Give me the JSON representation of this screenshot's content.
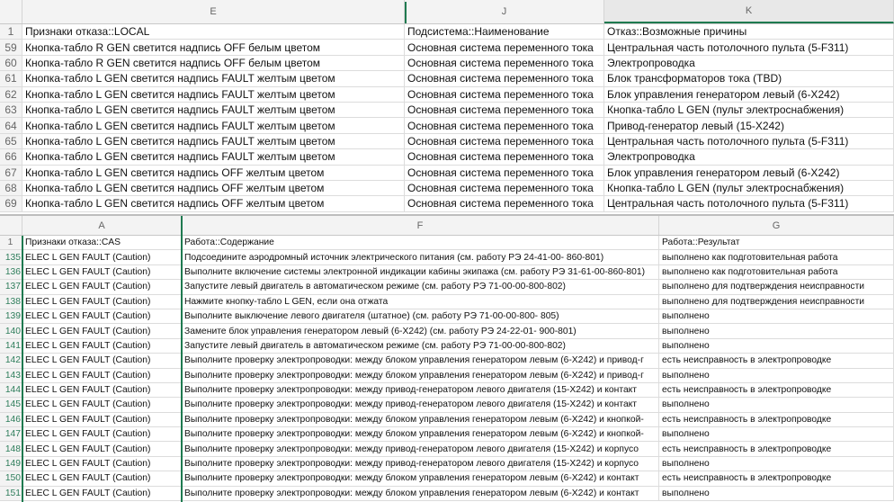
{
  "top_pane": {
    "columns": [
      "E",
      "J",
      "K"
    ],
    "header_row": {
      "num": "1",
      "cells": [
        "Признаки отказа::LOCAL",
        "Подсистема::Наименование",
        "Отказ::Возможные причины"
      ]
    },
    "rows": [
      {
        "num": "59",
        "cells": [
          "Кнопка-табло R GEN светится надпись OFF белым цветом",
          "Основная система переменного тока",
          "Центральная часть потолочного пульта (5-F311)"
        ]
      },
      {
        "num": "60",
        "cells": [
          "Кнопка-табло R GEN светится надпись OFF белым цветом",
          "Основная система переменного тока",
          "Электропроводка"
        ]
      },
      {
        "num": "61",
        "cells": [
          "Кнопка-табло L GEN светится надпись FAULT желтым цветом",
          "Основная система переменного тока",
          "Блок трансформаторов тока (TBD)"
        ]
      },
      {
        "num": "62",
        "cells": [
          "Кнопка-табло L GEN светится надпись FAULT желтым цветом",
          "Основная система переменного тока",
          "Блок управления генератором левый (6-X242)"
        ]
      },
      {
        "num": "63",
        "cells": [
          "Кнопка-табло L GEN светится надпись FAULT желтым цветом",
          "Основная система переменного тока",
          "Кнопка-табло L GEN (пульт электроснабжения)"
        ]
      },
      {
        "num": "64",
        "cells": [
          "Кнопка-табло L GEN светится надпись FAULT желтым цветом",
          "Основная система переменного тока",
          "Привод-генератор левый (15-X242)"
        ]
      },
      {
        "num": "65",
        "cells": [
          "Кнопка-табло L GEN светится надпись FAULT желтым цветом",
          "Основная система переменного тока",
          "Центральная часть потолочного пульта (5-F311)"
        ]
      },
      {
        "num": "66",
        "cells": [
          "Кнопка-табло L GEN светится надпись FAULT желтым цветом",
          "Основная система переменного тока",
          "Электропроводка"
        ]
      },
      {
        "num": "67",
        "cells": [
          "Кнопка-табло L GEN светится надпись OFF желтым цветом",
          "Основная система переменного тока",
          "Блок управления генератором левый (6-X242)"
        ]
      },
      {
        "num": "68",
        "cells": [
          "Кнопка-табло L GEN светится надпись OFF желтым цветом",
          "Основная система переменного тока",
          "Кнопка-табло L GEN (пульт электроснабжения)"
        ]
      },
      {
        "num": "69",
        "cells": [
          "Кнопка-табло L GEN светится надпись OFF желтым цветом",
          "Основная система переменного тока",
          "Центральная часть потолочного пульта (5-F311)"
        ]
      }
    ]
  },
  "bottom_pane": {
    "columns": [
      "A",
      "F",
      "G"
    ],
    "header_row": {
      "num": "1",
      "cells": [
        "Признаки отказа::CAS",
        "Работа::Содержание",
        "Работа::Результат"
      ]
    },
    "rows": [
      {
        "num": "135",
        "cells": [
          "ELEC L GEN FAULT (Caution)",
          "Подсоедините аэродромный источник электрического питания (см. работу РЭ 24-41-00- 860-801)",
          "выполнено как подготовительная работа"
        ]
      },
      {
        "num": "136",
        "cells": [
          "ELEC L GEN FAULT (Caution)",
          "Выполните включение системы электронной индикации кабины экипажа (см. работу РЭ 31-61-00-860-801)",
          "выполнено как подготовительная работа"
        ]
      },
      {
        "num": "137",
        "cells": [
          "ELEC L GEN FAULT (Caution)",
          "Запустите левый двигатель в автоматическом режиме (см. работу РЭ 71-00-00-800-802)",
          "выполнено для подтверждения неисправности"
        ]
      },
      {
        "num": "138",
        "cells": [
          "ELEC L GEN FAULT (Caution)",
          "Нажмите кнопку-табло L GEN, если она отжата",
          "выполнено для подтверждения неисправности"
        ]
      },
      {
        "num": "139",
        "cells": [
          "ELEC L GEN FAULT (Caution)",
          "Выполните выключение левого двигателя (штатное) (см. работу РЭ 71-00-00-800- 805)",
          "выполнено"
        ]
      },
      {
        "num": "140",
        "cells": [
          "ELEC L GEN FAULT (Caution)",
          "Замените блок управления генератором левый (6-X242) (см. работу РЭ 24-22-01- 900-801)",
          "выполнено"
        ]
      },
      {
        "num": "141",
        "cells": [
          "ELEC L GEN FAULT (Caution)",
          "Запустите левый двигатель в автоматическом режиме (см. работу РЭ 71-00-00-800-802)",
          "выполнено"
        ]
      },
      {
        "num": "142",
        "cells": [
          "ELEC L GEN FAULT (Caution)",
          "Выполните проверку электропроводки: между блоком управления генератором левым (6-X242) и привод-г",
          "есть неисправность в электропроводке"
        ]
      },
      {
        "num": "143",
        "cells": [
          "ELEC L GEN FAULT (Caution)",
          "Выполните проверку электропроводки: между блоком управления генератором левым (6-X242) и привод-г",
          "выполнено"
        ]
      },
      {
        "num": "144",
        "cells": [
          "ELEC L GEN FAULT (Caution)",
          "Выполните проверку электропроводки:  между привод-генератором левого двигателя (15-X242) и контакт",
          "есть неисправность в электропроводке"
        ]
      },
      {
        "num": "145",
        "cells": [
          "ELEC L GEN FAULT (Caution)",
          "Выполните проверку электропроводки:  между привод-генератором левого двигателя (15-X242) и контакт",
          "выполнено"
        ]
      },
      {
        "num": "146",
        "cells": [
          "ELEC L GEN FAULT (Caution)",
          "Выполните проверку электропроводки: между блоком управления генератором левым (6-X242) и кнопкой-",
          "есть неисправность в электропроводке"
        ]
      },
      {
        "num": "147",
        "cells": [
          "ELEC L GEN FAULT (Caution)",
          "Выполните проверку электропроводки: между блоком управления генератором левым (6-X242) и кнопкой-",
          "выполнено"
        ]
      },
      {
        "num": "148",
        "cells": [
          "ELEC L GEN FAULT (Caution)",
          "Выполните проверку электропроводки:  между привод-генератором левого двигателя (15-X242) и корпусо",
          "есть неисправность в электропроводке"
        ]
      },
      {
        "num": "149",
        "cells": [
          "ELEC L GEN FAULT (Caution)",
          "Выполните проверку электропроводки:  между привод-генератором левого двигателя (15-X242) и корпусо",
          "выполнено"
        ]
      },
      {
        "num": "150",
        "cells": [
          "ELEC L GEN FAULT (Caution)",
          "Выполните проверку электропроводки:  между блоком управления генератором левым (6-X242) и контакт",
          "есть неисправность в электропроводке"
        ]
      },
      {
        "num": "151",
        "cells": [
          "ELEC L GEN FAULT (Caution)",
          "Выполните проверку электропроводки:  между блоком управления генератором левым (6-X242) и контакт",
          "выполнено"
        ]
      }
    ]
  }
}
